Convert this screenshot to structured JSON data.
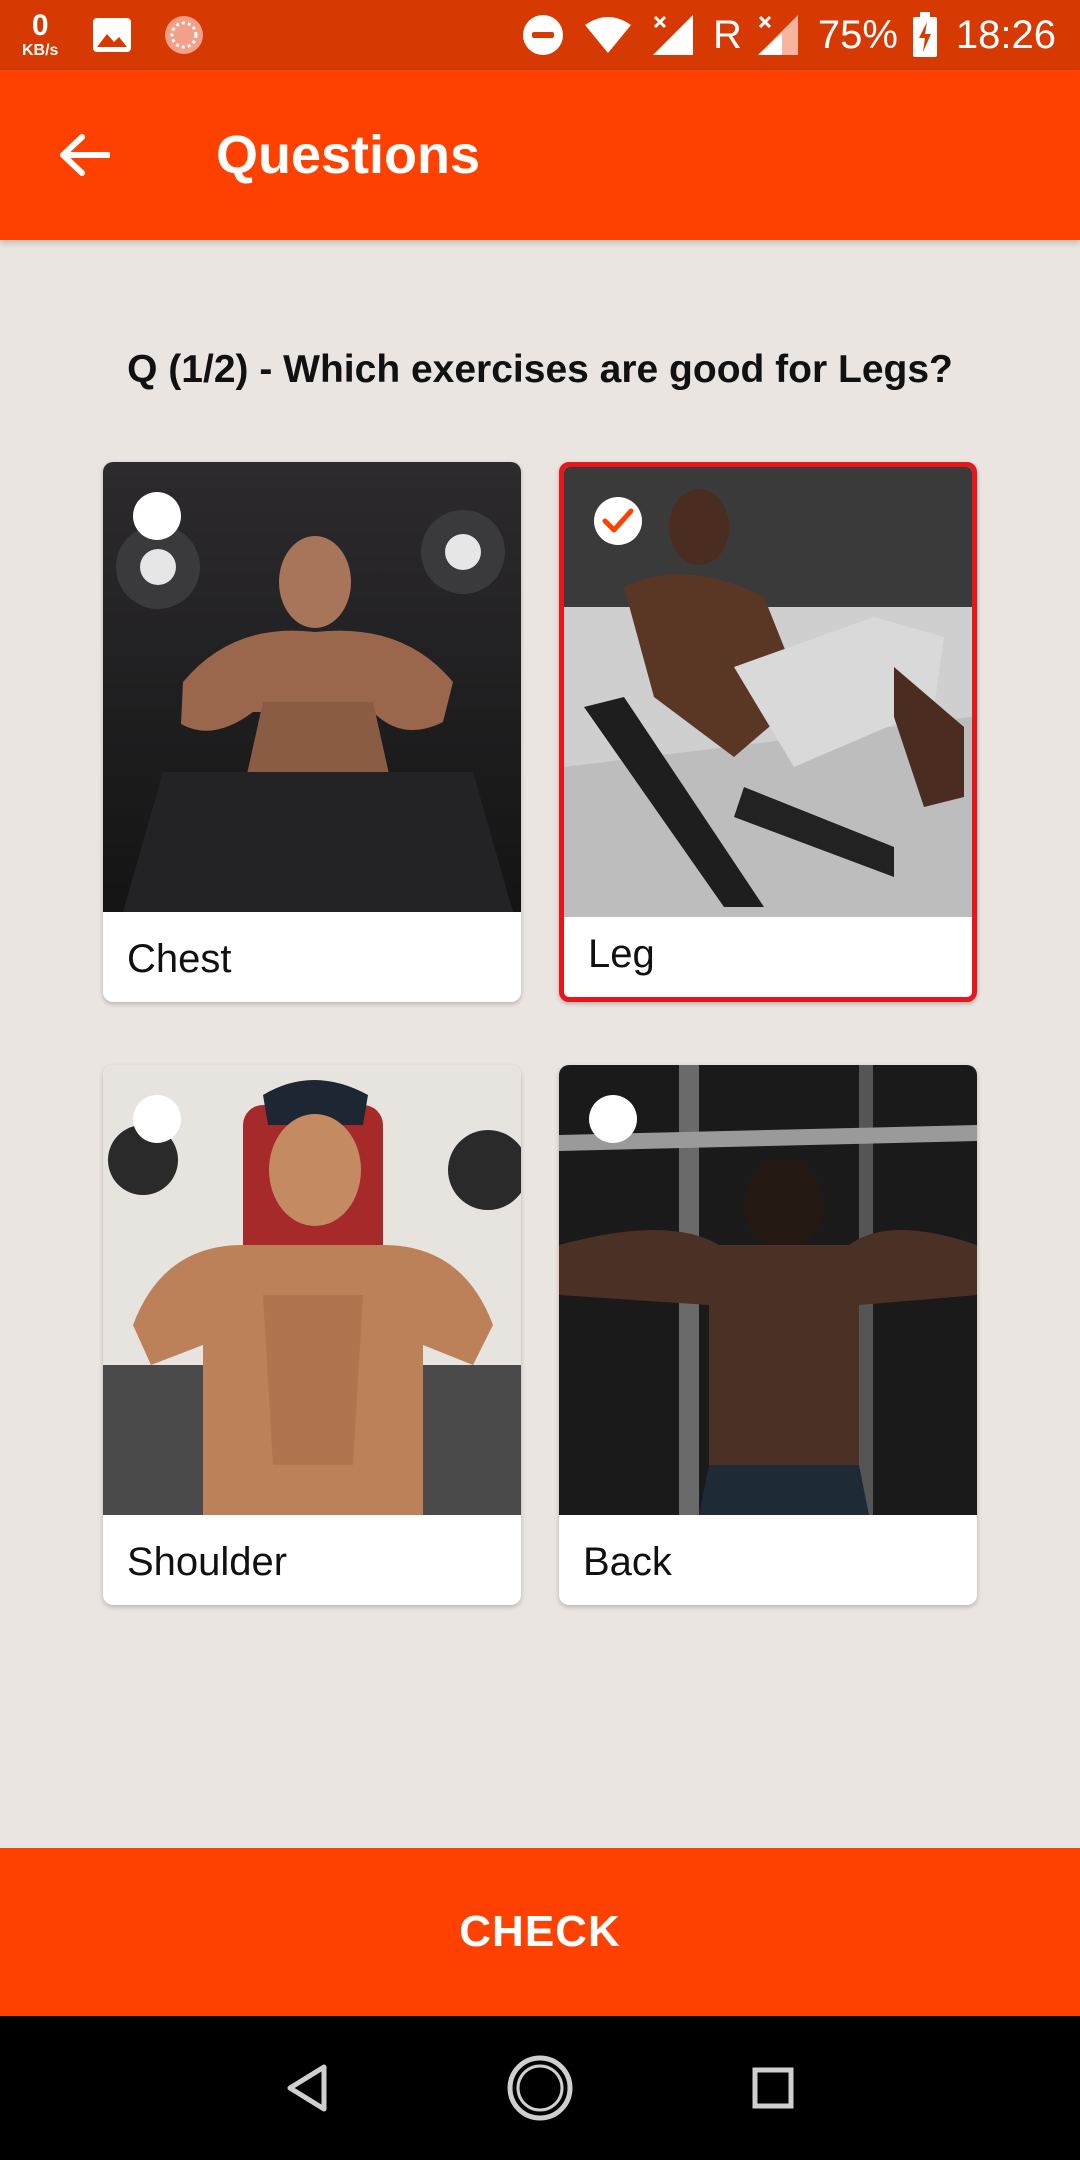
{
  "status_bar": {
    "speed_value": "0",
    "speed_unit": "KB/s",
    "roaming": "R",
    "battery": "75%",
    "time": "18:26",
    "icons": [
      "image-icon",
      "loader-icon",
      "dnd-icon",
      "wifi-icon",
      "signal-icon",
      "signal-icon",
      "battery-charging-icon"
    ]
  },
  "app_bar": {
    "back_icon": "arrow-left-icon",
    "title": "Questions"
  },
  "question": {
    "text": "Q (1/2) - Which exercises are good for Legs?"
  },
  "options": [
    {
      "label": "Chest",
      "selected": false
    },
    {
      "label": "Leg",
      "selected": true
    },
    {
      "label": "Shoulder",
      "selected": false
    },
    {
      "label": "Back",
      "selected": false
    }
  ],
  "check_button": {
    "label": "CHECK"
  },
  "colors": {
    "primary": "#fe4101",
    "status_bar": "#d63a02",
    "background": "#ebe5e1",
    "selected_border": "#e8161b"
  },
  "nav_bar": {
    "icons": [
      "back-triangle-icon",
      "home-circle-icon",
      "recents-square-icon"
    ]
  }
}
